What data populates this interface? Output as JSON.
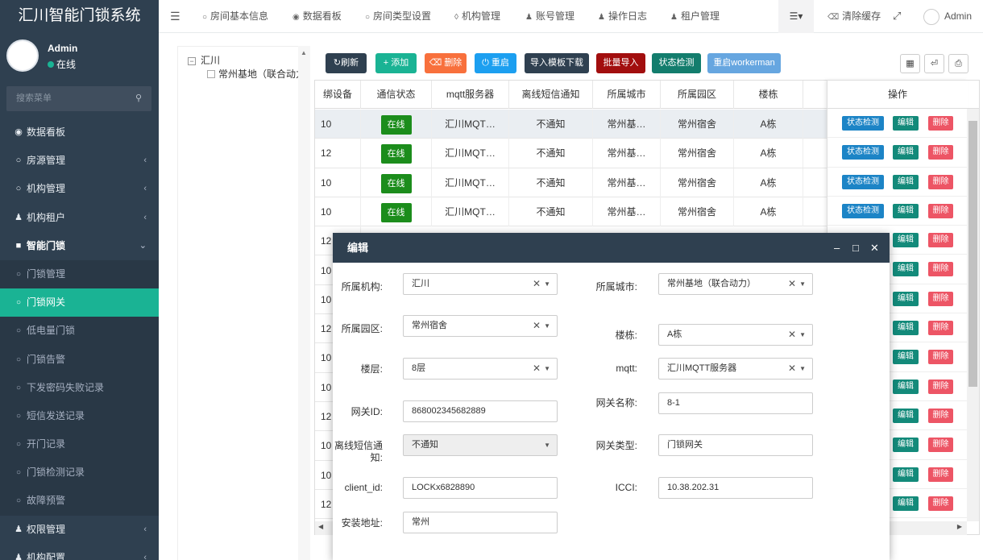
{
  "app": {
    "title": "汇川智能门锁系统"
  },
  "user": {
    "name": "Admin",
    "status": "在线"
  },
  "sidebar": {
    "search_placeholder": "搜索菜单",
    "items": [
      {
        "label": "数据看板"
      },
      {
        "label": "房源管理"
      },
      {
        "label": "机构管理"
      },
      {
        "label": "机构租户"
      },
      {
        "label": "智能门锁"
      },
      {
        "label": "门锁管理"
      },
      {
        "label": "门锁网关"
      },
      {
        "label": "低电量门锁"
      },
      {
        "label": "门锁告警"
      },
      {
        "label": "下发密码失败记录"
      },
      {
        "label": "短信发送记录"
      },
      {
        "label": "开门记录"
      },
      {
        "label": "门锁检测记录"
      },
      {
        "label": "故障预警"
      },
      {
        "label": "权限管理"
      },
      {
        "label": "机构配置"
      }
    ]
  },
  "topnav": {
    "items": [
      "房间基本信息",
      "数据看板",
      "房间类型设置",
      "机构管理",
      "账号管理",
      "操作日志",
      "租户管理"
    ],
    "clear_cache": "清除缓存",
    "user": "Admin"
  },
  "tree": {
    "root": "汇川",
    "child": "常州基地（联合动力）"
  },
  "toolbar": {
    "buttons": [
      "刷新",
      "添加",
      "删除",
      "重启",
      "导入模板下载",
      "批量导入",
      "状态检测",
      "重启workerman"
    ]
  },
  "table": {
    "columns": [
      "绑设备",
      "通信状态",
      "mqtt服务器",
      "离线短信通知",
      "所属城市",
      "所属园区",
      "楼栋"
    ],
    "ops_header": "操作",
    "ops_buttons": {
      "check": "状态检测",
      "edit": "编辑",
      "delete": "删除"
    },
    "rows": [
      {
        "devices": "10",
        "status": "在线",
        "mqtt": "汇川MQT…",
        "sms": "不通知",
        "city": "常州基…",
        "park": "常州宿舍",
        "building": "A栋"
      },
      {
        "devices": "12",
        "status": "在线",
        "mqtt": "汇川MQT…",
        "sms": "不通知",
        "city": "常州基…",
        "park": "常州宿舍",
        "building": "A栋"
      },
      {
        "devices": "10",
        "status": "在线",
        "mqtt": "汇川MQT…",
        "sms": "不通知",
        "city": "常州基…",
        "park": "常州宿舍",
        "building": "A栋"
      },
      {
        "devices": "10",
        "status": "在线",
        "mqtt": "汇川MQT…",
        "sms": "不通知",
        "city": "常州基…",
        "park": "常州宿舍",
        "building": "A栋"
      },
      {
        "devices": "12"
      },
      {
        "devices": "10"
      },
      {
        "devices": "10"
      },
      {
        "devices": "12"
      },
      {
        "devices": "10"
      },
      {
        "devices": "10"
      },
      {
        "devices": "12"
      },
      {
        "devices": "10"
      },
      {
        "devices": "10"
      },
      {
        "devices": "12"
      }
    ]
  },
  "modal": {
    "title": "编辑",
    "fields": {
      "org": {
        "label": "所属机构:",
        "value": "汇川"
      },
      "city": {
        "label": "所属城市:",
        "value": "常州基地（联合动力）"
      },
      "park": {
        "label": "所属园区:",
        "value": "常州宿舍"
      },
      "building": {
        "label": "楼栋:",
        "value": "A栋"
      },
      "floor": {
        "label": "楼层:",
        "value": "8层"
      },
      "mqtt": {
        "label": "mqtt:",
        "value": "汇川MQTT服务器"
      },
      "gateway_id": {
        "label": "网关ID:",
        "value": "868002345682889"
      },
      "gateway_name": {
        "label": "网关名称:",
        "value": "8-1"
      },
      "sms": {
        "label": "离线短信通知:",
        "value": "不通知"
      },
      "gateway_type": {
        "label": "网关类型:",
        "value": "门锁网关"
      },
      "client_id": {
        "label": "client_id:",
        "value": "LOCKx6828890"
      },
      "iccid": {
        "label": "ICCI:",
        "value": "10.38.202.31"
      },
      "address": {
        "label": "安装地址:",
        "value": "常州"
      }
    }
  }
}
